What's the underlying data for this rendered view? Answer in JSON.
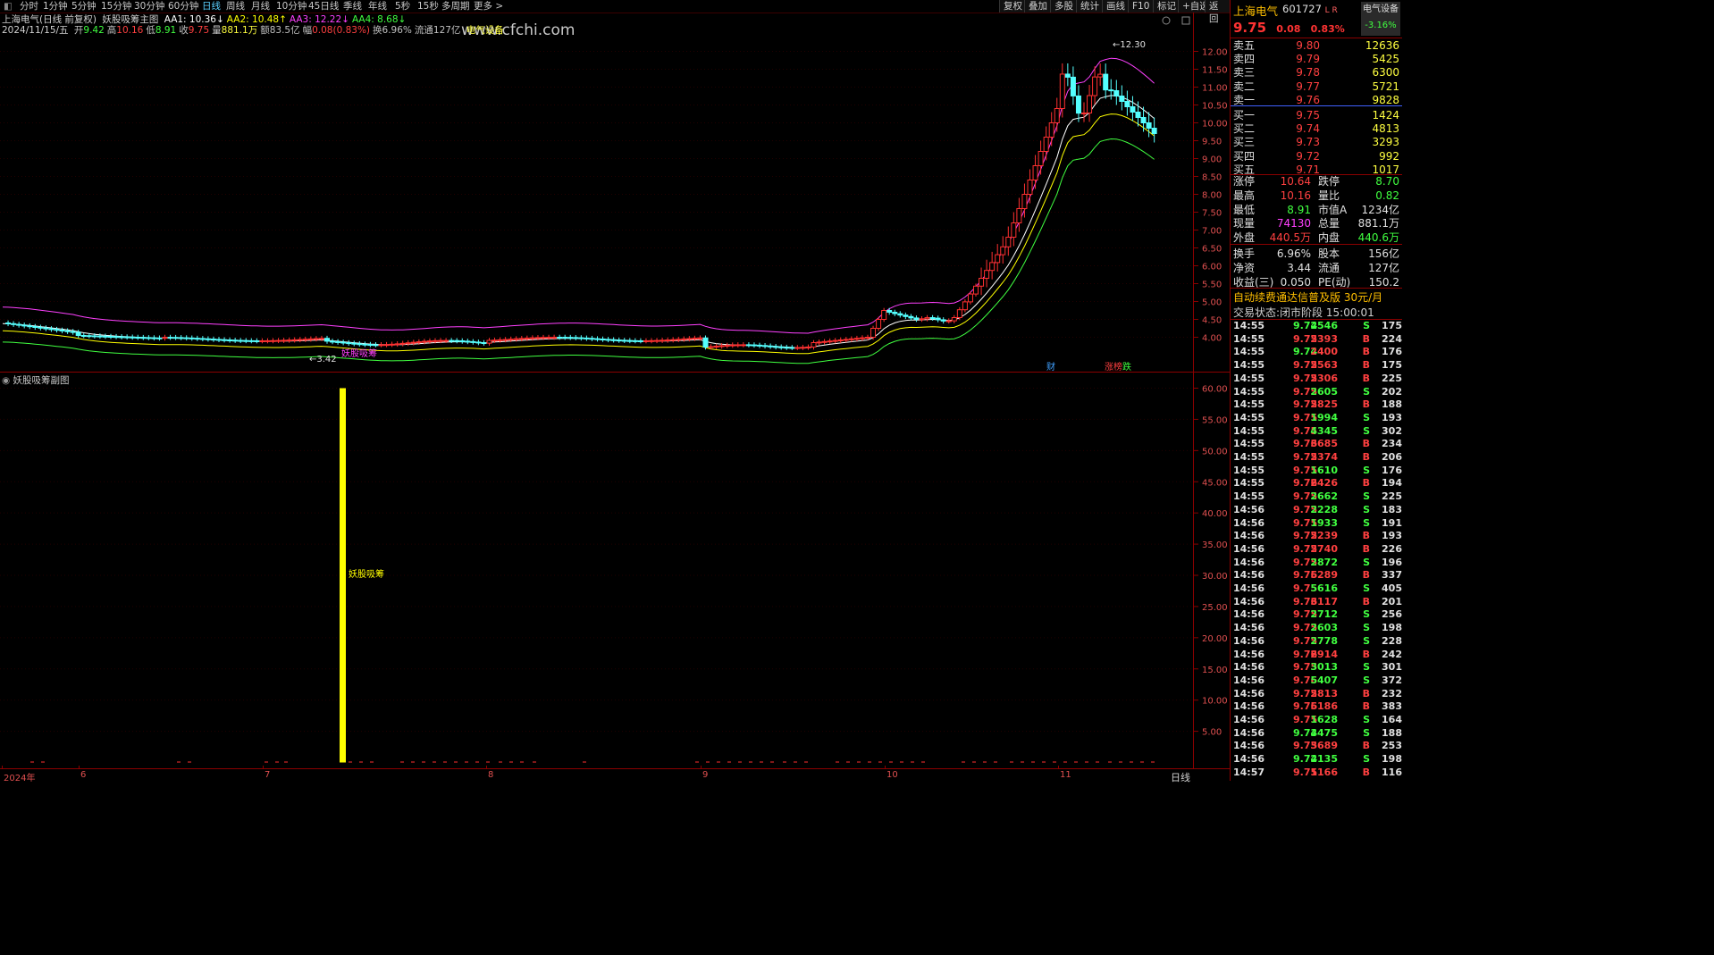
{
  "toolbar": {
    "periods": [
      "分时",
      "1分钟",
      "5分钟",
      "15分钟",
      "30分钟",
      "60分钟",
      "日线",
      "周线",
      "月线",
      "10分钟",
      "45日线",
      "季线",
      "年线",
      "5秒",
      "15秒",
      "多周期",
      "更多 >"
    ],
    "active_period": "日线",
    "right_buttons": [
      "复权",
      "叠加",
      "多股",
      "统计",
      "画线",
      "F10",
      "标记",
      "+自选",
      "返回"
    ]
  },
  "header": {
    "stock_label": "上海电气(日线 前复权)",
    "indicator_name": "妖股吸筹主图",
    "aa": [
      {
        "label": "AA1: 10.36",
        "arrow": "↓",
        "color": "#ffffff"
      },
      {
        "label": "AA2: 10.48",
        "arrow": "↑",
        "color": "#ffff00"
      },
      {
        "label": "AA3: 12.22",
        "arrow": "↓",
        "color": "#ff40ff"
      },
      {
        "label": "AA4: 8.68",
        "arrow": "↓",
        "color": "#40ff40"
      }
    ],
    "watermark": "www.cfchi.com",
    "date": "2024/11/15/五",
    "stats": [
      {
        "k": "开",
        "v": "9.42",
        "c": "#40ff40"
      },
      {
        "k": "高",
        "v": "10.16",
        "c": "#ff4040"
      },
      {
        "k": "低",
        "v": "8.91",
        "c": "#40ff40"
      },
      {
        "k": "收",
        "v": "9.75",
        "c": "#ff4040"
      },
      {
        "k": "量",
        "v": "881.1万",
        "c": "#ffff40"
      },
      {
        "k": "额",
        "v": "83.5亿",
        "c": "#c0c0c0"
      },
      {
        "k": "幅",
        "v": "0.08(0.83%)",
        "c": "#ff4040"
      },
      {
        "k": "换",
        "v": "6.96%",
        "c": "#c0c0c0"
      },
      {
        "k": "流通",
        "v": "127亿",
        "c": "#c0c0c0"
      }
    ],
    "sector": "电气设备"
  },
  "main_chart": {
    "y_ticks": [
      "12.00",
      "11.50",
      "11.00",
      "10.50",
      "10.00",
      "9.50",
      "9.00",
      "8.50",
      "8.00",
      "7.50",
      "7.00",
      "6.50",
      "6.00",
      "5.50",
      "5.00",
      "4.50",
      "4.00"
    ],
    "high_label": "12.30",
    "low_label": "3.42",
    "marker_text": "妖股吸筹",
    "event_labels": [
      "财",
      "涨",
      "榜",
      "跌"
    ]
  },
  "sub_chart": {
    "title": "妖股吸筹副图",
    "y_ticks": [
      "60.00",
      "55.00",
      "50.00",
      "45.00",
      "40.00",
      "35.00",
      "30.00",
      "25.00",
      "20.00",
      "15.00",
      "10.00",
      "5.00"
    ],
    "bar_label": "妖股吸筹",
    "bar_value": 60
  },
  "x_axis": {
    "labels": [
      "2024年",
      "6",
      "7",
      "8",
      "9",
      "10",
      "11"
    ],
    "mode": "日线"
  },
  "quote_panel": {
    "name": "上海电气",
    "code": "601727",
    "flags": "L R",
    "tag": "电气设备",
    "tag_change": "-3.16%",
    "price": "9.75",
    "change": "0.08",
    "change_pct": "0.83%",
    "asks": [
      {
        "label": "卖五",
        "price": "9.80",
        "vol": "12636"
      },
      {
        "label": "卖四",
        "price": "9.79",
        "vol": "5425"
      },
      {
        "label": "卖三",
        "price": "9.78",
        "vol": "6300"
      },
      {
        "label": "卖二",
        "price": "9.77",
        "vol": "5721"
      },
      {
        "label": "卖一",
        "price": "9.76",
        "vol": "9828"
      }
    ],
    "bids": [
      {
        "label": "买一",
        "price": "9.75",
        "vol": "1424"
      },
      {
        "label": "买二",
        "price": "9.74",
        "vol": "4813"
      },
      {
        "label": "买三",
        "price": "9.73",
        "vol": "3293"
      },
      {
        "label": "买四",
        "price": "9.72",
        "vol": "992"
      },
      {
        "label": "买五",
        "price": "9.71",
        "vol": "1017"
      }
    ],
    "stats": [
      {
        "l1": "涨停",
        "v1": "10.64",
        "c1": "#ff4040",
        "l2": "跌停",
        "v2": "8.70",
        "c2": "#40ff40"
      },
      {
        "l1": "最高",
        "v1": "10.16",
        "c1": "#ff4040",
        "l2": "量比",
        "v2": "0.82",
        "c2": "#40ff40"
      },
      {
        "l1": "最低",
        "v1": "8.91",
        "c1": "#40ff40",
        "l2": "市值A",
        "v2": "1234亿",
        "c2": "#e0e0e0"
      },
      {
        "l1": "现量",
        "v1": "74130",
        "c1": "#ff40ff",
        "l2": "总量",
        "v2": "881.1万",
        "c2": "#e0e0e0"
      },
      {
        "l1": "外盘",
        "v1": "440.5万",
        "c1": "#ff4040",
        "l2": "内盘",
        "v2": "440.6万",
        "c2": "#40ff40"
      },
      {
        "l1": "换手",
        "v1": "6.96%",
        "c1": "#e0e0e0",
        "l2": "股本",
        "v2": "156亿",
        "c2": "#e0e0e0"
      },
      {
        "l1": "净资",
        "v1": "3.44",
        "c1": "#e0e0e0",
        "l2": "流通",
        "v2": "127亿",
        "c2": "#e0e0e0"
      },
      {
        "l1": "收益(三)",
        "v1": "0.050",
        "c1": "#e0e0e0",
        "l2": "PE(动)",
        "v2": "150.2",
        "c2": "#e0e0e0"
      }
    ],
    "promo": "自动续费通达信普及版",
    "promo_price": "30元/月",
    "status_label": "交易状态:",
    "status_value": "闭市阶段",
    "status_time": "15:00:01",
    "ticks": [
      [
        "14:55",
        "9.74",
        "2546",
        "S",
        "175"
      ],
      [
        "14:55",
        "9.75",
        "2393",
        "B",
        "224"
      ],
      [
        "14:55",
        "9.74",
        "2400",
        "B",
        "176"
      ],
      [
        "14:55",
        "9.75",
        "2563",
        "B",
        "175"
      ],
      [
        "14:55",
        "9.75",
        "2306",
        "B",
        "225"
      ],
      [
        "14:55",
        "9.75",
        "2605",
        "S",
        "202"
      ],
      [
        "14:55",
        "9.75",
        "2825",
        "B",
        "188"
      ],
      [
        "14:55",
        "9.75",
        "1994",
        "S",
        "193"
      ],
      [
        "14:55",
        "9.75",
        "4345",
        "S",
        "302"
      ],
      [
        "14:55",
        "9.76",
        "3685",
        "B",
        "234"
      ],
      [
        "14:55",
        "9.75",
        "2374",
        "B",
        "206"
      ],
      [
        "14:55",
        "9.75",
        "1610",
        "S",
        "176"
      ],
      [
        "14:55",
        "9.76",
        "2426",
        "B",
        "194"
      ],
      [
        "14:55",
        "9.75",
        "2662",
        "S",
        "225"
      ],
      [
        "14:56",
        "9.75",
        "2228",
        "S",
        "183"
      ],
      [
        "14:56",
        "9.75",
        "1933",
        "S",
        "191"
      ],
      [
        "14:56",
        "9.75",
        "2239",
        "B",
        "193"
      ],
      [
        "14:56",
        "9.75",
        "2740",
        "B",
        "226"
      ],
      [
        "14:56",
        "9.75",
        "2872",
        "S",
        "196"
      ],
      [
        "14:56",
        "9.76",
        "5289",
        "B",
        "337"
      ],
      [
        "14:56",
        "9.75",
        "5616",
        "S",
        "405"
      ],
      [
        "14:56",
        "9.76",
        "3117",
        "B",
        "201"
      ],
      [
        "14:56",
        "9.75",
        "2712",
        "S",
        "256"
      ],
      [
        "14:56",
        "9.75",
        "2603",
        "S",
        "198"
      ],
      [
        "14:56",
        "9.75",
        "2778",
        "S",
        "228"
      ],
      [
        "14:56",
        "9.76",
        "2914",
        "B",
        "242"
      ],
      [
        "14:56",
        "9.75",
        "3013",
        "S",
        "301"
      ],
      [
        "14:56",
        "9.76",
        "5407",
        "S",
        "372"
      ],
      [
        "14:56",
        "9.75",
        "2813",
        "B",
        "232"
      ],
      [
        "14:56",
        "9.76",
        "5186",
        "B",
        "383"
      ],
      [
        "14:56",
        "9.75",
        "1628",
        "S",
        "164"
      ],
      [
        "14:56",
        "9.74",
        "3475",
        "S",
        "188"
      ],
      [
        "14:56",
        "9.75",
        "3689",
        "B",
        "253"
      ],
      [
        "14:56",
        "9.74",
        "2135",
        "S",
        "198"
      ],
      [
        "14:57",
        "9.75",
        "1166",
        "B",
        "116"
      ]
    ]
  }
}
